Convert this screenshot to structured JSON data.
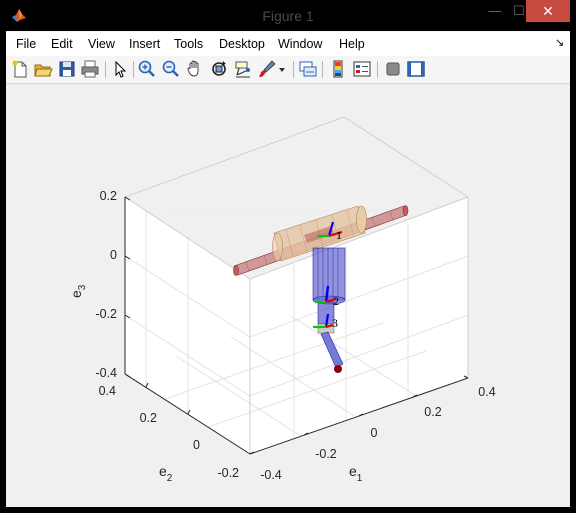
{
  "window": {
    "title": "Figure 1",
    "controls": {
      "minimize": "—",
      "maximize": "☐",
      "close": "✕"
    }
  },
  "menubar": {
    "items": [
      "File",
      "Edit",
      "View",
      "Insert",
      "Tools",
      "Desktop",
      "Window",
      "Help"
    ],
    "corner_glyph": "↘"
  },
  "toolbar": {
    "buttons": [
      "new-figure-icon",
      "open-file-icon",
      "save-icon",
      "print-icon",
      "edit-plot-arrow-icon",
      "zoom-in-icon",
      "zoom-out-icon",
      "pan-hand-icon",
      "rotate-3d-icon",
      "data-cursor-icon",
      "brush-icon",
      "brush-dropdown-icon",
      "link-plot-icon",
      "insert-colorbar-icon",
      "insert-legend-icon",
      "hide-plot-tools-icon",
      "show-plot-tools-icon"
    ]
  },
  "plot": {
    "x_label_base": "e",
    "x_label_sub": "1",
    "y_label_base": "e",
    "y_label_sub": "2",
    "z_label_base": "e",
    "z_label_sub": "3",
    "x_ticks": [
      "-0.4",
      "-0.2",
      "0",
      "0.2",
      "0.4"
    ],
    "y_ticks": [
      "-0.2",
      "0",
      "0.2",
      "0.4"
    ],
    "z_ticks": [
      "0.2",
      "0",
      "-0.2",
      "-0.4"
    ],
    "frame_labels": [
      "1",
      "2",
      "3"
    ],
    "colors": {
      "cylinder_red": "#b85050",
      "cylinder_tan": "#e4c4a2",
      "link_blue": "#5858cc",
      "frame_blue": "#0000ee",
      "frame_green": "#00cc00",
      "frame_red": "#dd0000",
      "end_effector": "#8a0000"
    }
  }
}
